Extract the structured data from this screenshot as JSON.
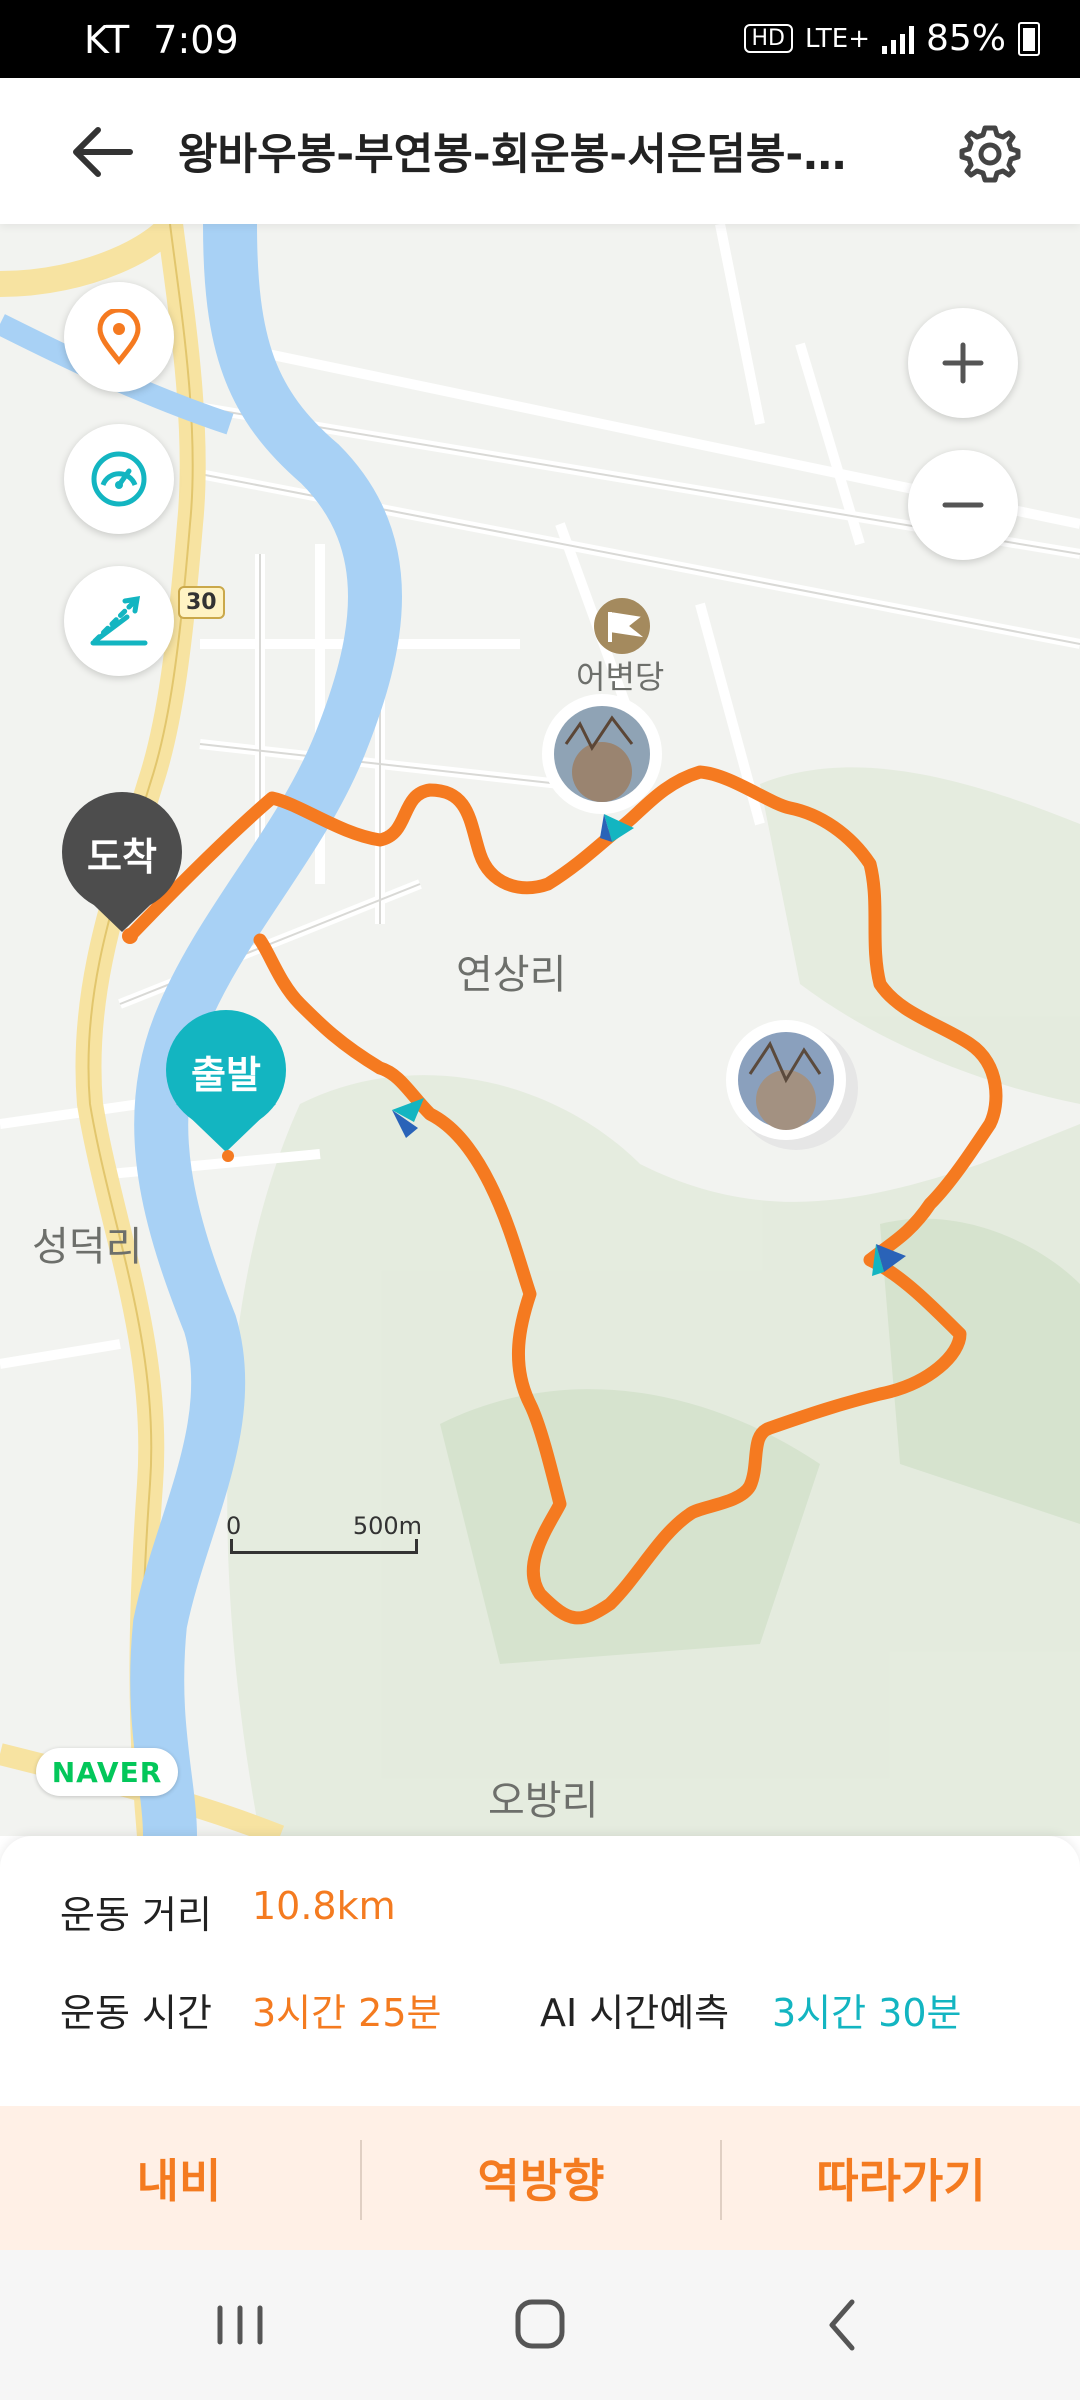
{
  "status_bar": {
    "carrier": "KT",
    "time": "7:09",
    "hd": "HD",
    "network": "LTE+",
    "battery": "85%"
  },
  "header": {
    "title": "왕바우봉-부연봉-회운봉-서은덤봉-애...",
    "back_icon": "arrow-left-icon",
    "settings_icon": "gear-icon"
  },
  "map": {
    "places": {
      "eobyeondang": "어변당",
      "yeonsang": "연상리",
      "seongdeok": "성덕리",
      "obang": "오방리"
    },
    "route_number": "30",
    "start_label": "출발",
    "end_label": "도착",
    "naver": "NAVER",
    "scale_zero": "0",
    "scale_distance": "500m",
    "controls": {
      "location": "location-pin-icon",
      "speed": "gauge-icon",
      "elevation": "elevation-icon",
      "zoom_in": "plus-icon",
      "zoom_out": "minus-icon"
    },
    "colors": {
      "route": "#F57A20",
      "start": "#13B5C1",
      "end": "#555555",
      "river": "#A8D1F5",
      "road": "#F7E3A1"
    }
  },
  "stats": {
    "distance_label": "운동 거리",
    "distance_value": "10.8km",
    "time_label": "운동 시간",
    "time_value": "3시간 25분",
    "ai_label": "AI 시간예측",
    "ai_value": "3시간 30분"
  },
  "actions": {
    "navi": "내비",
    "reverse": "역방향",
    "follow": "따라가기"
  },
  "nav_bar": {
    "recent": "recent-apps-icon",
    "home": "home-icon",
    "back": "back-chevron-icon"
  }
}
